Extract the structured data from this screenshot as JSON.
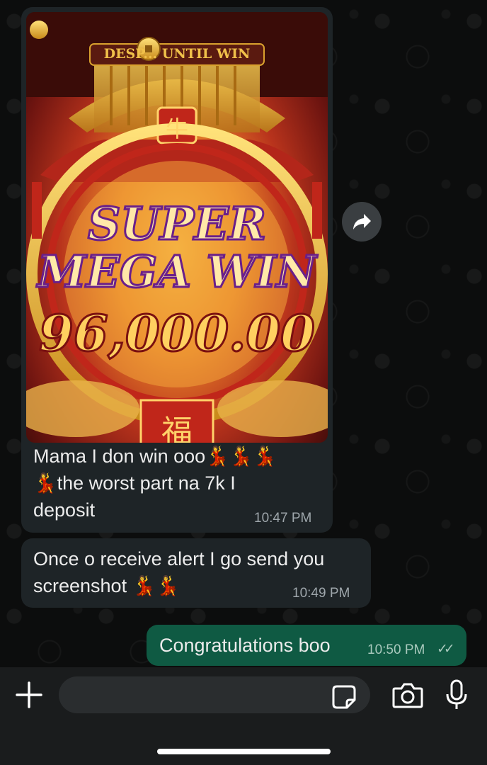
{
  "conversation": {
    "media_message": {
      "image_text": {
        "banner": "DESP... UNTIL WIN",
        "line1": "SUPER",
        "line2": "MEGA WIN",
        "amount": "96,000.00",
        "fu_glyph": "福",
        "ox_glyph": "牛"
      },
      "caption_line1": "Mama I don win ooo💃💃💃",
      "caption_line2": "💃the worst part na 7k I",
      "caption_line3": "deposit",
      "time": "10:47 PM"
    },
    "text_message": {
      "line1": "Once o receive alert I go send you",
      "line2": "screenshot 💃💃",
      "time": "10:49 PM"
    },
    "outgoing_message": {
      "text": "Congratulations boo",
      "time": "10:50 PM",
      "status": "✓✓"
    }
  },
  "icons": {
    "forward": "forward-arrow-icon",
    "plus": "plus-icon",
    "sticker": "sticker-icon",
    "camera": "camera-icon",
    "mic": "microphone-icon"
  },
  "colors": {
    "background": "#0c0d0d",
    "incoming_bubble": "#1e2427",
    "outgoing_bubble": "#0f5a43",
    "timestamp": "#9ea6ab",
    "input_field": "#2a2d2f"
  }
}
